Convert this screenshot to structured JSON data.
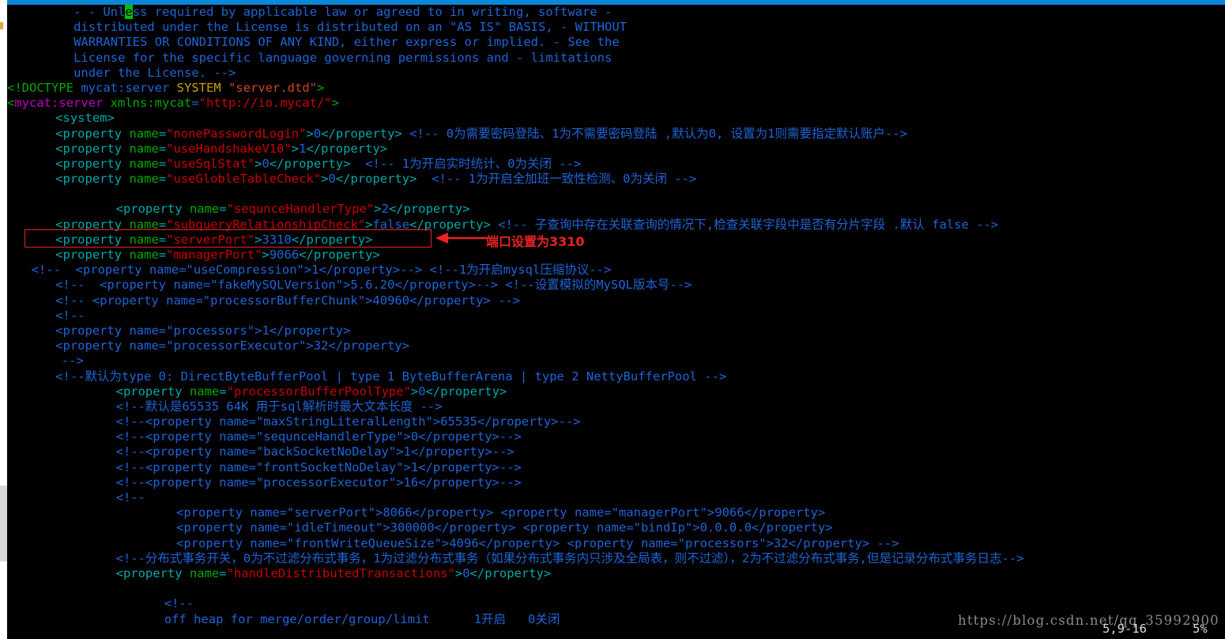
{
  "window": {
    "titlebar_color": "#0b87d8",
    "background": "#000000"
  },
  "editor": {
    "type": "vim",
    "filetype": "xml",
    "cursor": {
      "line": 5,
      "col": "9-16",
      "char": "e"
    },
    "status": {
      "position": "5,9-16",
      "percent": "5%"
    },
    "lines": [
      {
        "indent": 11,
        "segments": [
          {
            "t": "- - Unl",
            "c": "c-comment"
          },
          {
            "t": "e",
            "c": "cursor"
          },
          {
            "t": "ss required by applicable law or agreed to in writing, software -",
            "c": "c-comment"
          }
        ]
      },
      {
        "indent": 11,
        "segments": [
          {
            "t": "distributed under the License is distributed on an \"AS IS\" BASIS, - WITHOUT",
            "c": "c-comment"
          }
        ]
      },
      {
        "indent": 11,
        "segments": [
          {
            "t": "WARRANTIES OR CONDITIONS OF ANY KIND, either express or implied. - See the",
            "c": "c-comment"
          }
        ]
      },
      {
        "indent": 11,
        "segments": [
          {
            "t": "License for the specific language governing permissions and - limitations",
            "c": "c-comment"
          }
        ]
      },
      {
        "indent": 11,
        "segments": [
          {
            "t": "under the License. -->",
            "c": "c-comment"
          }
        ]
      },
      {
        "indent": 0,
        "segments": [
          {
            "t": "<!DOCTYPE",
            "c": "c-doctype"
          },
          {
            "t": " mycat:server ",
            "c": "c-plain"
          },
          {
            "t": "SYSTEM",
            "c": "c-dt-kw"
          },
          {
            "t": " ",
            "c": "c-plain"
          },
          {
            "t": "\"server.dtd\"",
            "c": "c-dt-str"
          },
          {
            "t": ">",
            "c": "c-doctype"
          }
        ]
      },
      {
        "indent": 0,
        "segments": [
          {
            "t": "<",
            "c": "c-doctype"
          },
          {
            "t": "mycat:server",
            "c": "c-ns"
          },
          {
            "t": " ",
            "c": "c-plain"
          },
          {
            "t": "xmlns:mycat",
            "c": "c-attr"
          },
          {
            "t": "=",
            "c": "c-plain"
          },
          {
            "t": "\"http://io.mycat/\"",
            "c": "c-str"
          },
          {
            "t": ">",
            "c": "c-doctype"
          }
        ]
      },
      {
        "indent": 8,
        "segments": [
          {
            "t": "<system>",
            "c": "c-tag"
          }
        ]
      },
      {
        "indent": 8,
        "segments": [
          {
            "t": "<property ",
            "c": "c-tag"
          },
          {
            "t": "name",
            "c": "c-attr"
          },
          {
            "t": "=",
            "c": "c-tag"
          },
          {
            "t": "\"nonePasswordLogin\"",
            "c": "c-str"
          },
          {
            "t": ">",
            "c": "c-tag"
          },
          {
            "t": "0",
            "c": "c-val"
          },
          {
            "t": "</property>",
            "c": "c-tag"
          },
          {
            "t": " <!-- 0为需要密码登陆、1为不需要密码登陆 ,默认为0, 设置为1则需要指定默认账户-->",
            "c": "c-comment"
          }
        ]
      },
      {
        "indent": 8,
        "segments": [
          {
            "t": "<property ",
            "c": "c-tag"
          },
          {
            "t": "name",
            "c": "c-attr"
          },
          {
            "t": "=",
            "c": "c-tag"
          },
          {
            "t": "\"useHandshakeV10\"",
            "c": "c-str"
          },
          {
            "t": ">",
            "c": "c-tag"
          },
          {
            "t": "1",
            "c": "c-val"
          },
          {
            "t": "</property>",
            "c": "c-tag"
          }
        ]
      },
      {
        "indent": 8,
        "segments": [
          {
            "t": "<property ",
            "c": "c-tag"
          },
          {
            "t": "name",
            "c": "c-attr"
          },
          {
            "t": "=",
            "c": "c-tag"
          },
          {
            "t": "\"useSqlStat\"",
            "c": "c-str"
          },
          {
            "t": ">",
            "c": "c-tag"
          },
          {
            "t": "0",
            "c": "c-val"
          },
          {
            "t": "</property>",
            "c": "c-tag"
          },
          {
            "t": "  <!-- 1为开启实时统计、0为关闭 -->",
            "c": "c-comment"
          }
        ]
      },
      {
        "indent": 8,
        "segments": [
          {
            "t": "<property ",
            "c": "c-tag"
          },
          {
            "t": "name",
            "c": "c-attr"
          },
          {
            "t": "=",
            "c": "c-tag"
          },
          {
            "t": "\"useGlobleTableCheck\"",
            "c": "c-str"
          },
          {
            "t": ">",
            "c": "c-tag"
          },
          {
            "t": "0",
            "c": "c-val"
          },
          {
            "t": "</property>",
            "c": "c-tag"
          },
          {
            "t": "  <!-- 1为开启全加班一致性检测、0为关闭 -->",
            "c": "c-comment"
          }
        ]
      },
      {
        "indent": 0,
        "segments": [
          {
            "t": "",
            "c": "c-plain"
          }
        ]
      },
      {
        "indent": 18,
        "segments": [
          {
            "t": "<property ",
            "c": "c-tag"
          },
          {
            "t": "name",
            "c": "c-attr"
          },
          {
            "t": "=",
            "c": "c-tag"
          },
          {
            "t": "\"sequnceHandlerType\"",
            "c": "c-str"
          },
          {
            "t": ">",
            "c": "c-tag"
          },
          {
            "t": "2",
            "c": "c-val"
          },
          {
            "t": "</property>",
            "c": "c-tag"
          }
        ]
      },
      {
        "indent": 8,
        "segments": [
          {
            "t": "<property ",
            "c": "c-tag"
          },
          {
            "t": "name",
            "c": "c-attr"
          },
          {
            "t": "=",
            "c": "c-tag"
          },
          {
            "t": "\"subqueryRelationshipCheck\"",
            "c": "c-str"
          },
          {
            "t": ">",
            "c": "c-tag"
          },
          {
            "t": "false",
            "c": "c-val"
          },
          {
            "t": "</property>",
            "c": "c-tag"
          },
          {
            "t": " <!-- 子查询中存在关联查询的情况下,检查关联字段中是否有分片字段 .默认 false -->",
            "c": "c-comment"
          }
        ]
      },
      {
        "indent": 8,
        "segments": [
          {
            "t": "<property ",
            "c": "c-tag"
          },
          {
            "t": "name",
            "c": "c-attr"
          },
          {
            "t": "=",
            "c": "c-tag"
          },
          {
            "t": "\"serverPort\"",
            "c": "c-str"
          },
          {
            "t": ">",
            "c": "c-tag"
          },
          {
            "t": "3310",
            "c": "c-val"
          },
          {
            "t": "</property>",
            "c": "c-tag"
          }
        ]
      },
      {
        "indent": 8,
        "segments": [
          {
            "t": "<property ",
            "c": "c-tag"
          },
          {
            "t": "name",
            "c": "c-attr"
          },
          {
            "t": "=",
            "c": "c-tag"
          },
          {
            "t": "\"managerPort\"",
            "c": "c-str"
          },
          {
            "t": ">",
            "c": "c-tag"
          },
          {
            "t": "9066",
            "c": "c-val"
          },
          {
            "t": "</property>",
            "c": "c-tag"
          }
        ]
      },
      {
        "indent": 4,
        "segments": [
          {
            "t": "<!--  <property name=\"useCompression\">1</property>--> <!--1为开启mysql压缩协议-->",
            "c": "c-comment"
          }
        ]
      },
      {
        "indent": 8,
        "segments": [
          {
            "t": "<!--  <property name=\"fakeMySQLVersion\">5.6.20</property>--> <!--设置模拟的MySQL版本号-->",
            "c": "c-comment"
          }
        ]
      },
      {
        "indent": 8,
        "segments": [
          {
            "t": "<!-- <property name=\"processorBufferChunk\">40960</property> -->",
            "c": "c-comment"
          }
        ]
      },
      {
        "indent": 8,
        "segments": [
          {
            "t": "<!--",
            "c": "c-comment"
          }
        ]
      },
      {
        "indent": 8,
        "segments": [
          {
            "t": "<property name=\"processors\">1</property>",
            "c": "c-comment"
          }
        ]
      },
      {
        "indent": 8,
        "segments": [
          {
            "t": "<property name=\"processorExecutor\">32</property>",
            "c": "c-comment"
          }
        ]
      },
      {
        "indent": 9,
        "segments": [
          {
            "t": "-->",
            "c": "c-comment"
          }
        ]
      },
      {
        "indent": 8,
        "segments": [
          {
            "t": "<!--默认为type 0: DirectByteBufferPool | type 1 ByteBufferArena | type 2 NettyBufferPool -->",
            "c": "c-comment"
          }
        ]
      },
      {
        "indent": 18,
        "segments": [
          {
            "t": "<property ",
            "c": "c-tag"
          },
          {
            "t": "name",
            "c": "c-attr"
          },
          {
            "t": "=",
            "c": "c-tag"
          },
          {
            "t": "\"processorBufferPoolType\"",
            "c": "c-str"
          },
          {
            "t": ">",
            "c": "c-tag"
          },
          {
            "t": "0",
            "c": "c-val"
          },
          {
            "t": "</property>",
            "c": "c-tag"
          }
        ]
      },
      {
        "indent": 18,
        "segments": [
          {
            "t": "<!--默认是65535 64K 用于sql解析时最大文本长度 -->",
            "c": "c-comment"
          }
        ]
      },
      {
        "indent": 18,
        "segments": [
          {
            "t": "<!--<property name=\"maxStringLiteralLength\">65535</property>-->",
            "c": "c-comment"
          }
        ]
      },
      {
        "indent": 18,
        "segments": [
          {
            "t": "<!--<property name=\"sequnceHandlerType\">0</property>-->",
            "c": "c-comment"
          }
        ]
      },
      {
        "indent": 18,
        "segments": [
          {
            "t": "<!--<property name=\"backSocketNoDelay\">1</property>-->",
            "c": "c-comment"
          }
        ]
      },
      {
        "indent": 18,
        "segments": [
          {
            "t": "<!--<property name=\"frontSocketNoDelay\">1</property>-->",
            "c": "c-comment"
          }
        ]
      },
      {
        "indent": 18,
        "segments": [
          {
            "t": "<!--<property name=\"processorExecutor\">16</property>-->",
            "c": "c-comment"
          }
        ]
      },
      {
        "indent": 18,
        "segments": [
          {
            "t": "<!--",
            "c": "c-comment"
          }
        ]
      },
      {
        "indent": 28,
        "segments": [
          {
            "t": "<property name=\"serverPort\">8066</property> <property name=\"managerPort\">9066</property>",
            "c": "c-comment"
          }
        ]
      },
      {
        "indent": 28,
        "segments": [
          {
            "t": "<property name=\"idleTimeout\">300000</property> <property name=\"bindIp\">0.0.0.0</property>",
            "c": "c-comment"
          }
        ]
      },
      {
        "indent": 28,
        "segments": [
          {
            "t": "<property name=\"frontWriteQueueSize\">4096</property> <property name=\"processors\">32</property> -->",
            "c": "c-comment"
          }
        ]
      },
      {
        "indent": 18,
        "segments": [
          {
            "t": "<!--分布式事务开关，0为不过滤分布式事务，1为过滤分布式事务（如果分布式事务内只涉及全局表，则不过滤），2为不过滤分布式事务,但是记录分布式事务日志-->",
            "c": "c-comment"
          }
        ]
      },
      {
        "indent": 18,
        "segments": [
          {
            "t": "<property ",
            "c": "c-tag"
          },
          {
            "t": "name",
            "c": "c-attr"
          },
          {
            "t": "=",
            "c": "c-tag"
          },
          {
            "t": "\"handleDistributedTransactions\"",
            "c": "c-str"
          },
          {
            "t": ">",
            "c": "c-tag"
          },
          {
            "t": "0",
            "c": "c-val"
          },
          {
            "t": "</property>",
            "c": "c-tag"
          }
        ]
      },
      {
        "indent": 0,
        "segments": [
          {
            "t": "",
            "c": "c-plain"
          }
        ]
      },
      {
        "indent": 26,
        "segments": [
          {
            "t": "<!--",
            "c": "c-comment"
          }
        ]
      },
      {
        "indent": 26,
        "segments": [
          {
            "t": "off heap for merge/order/group/limit      1开启   0关闭",
            "c": "c-comment"
          }
        ]
      }
    ]
  },
  "annotation": {
    "box_label": "serverPort-highlight",
    "arrow_label": "annotation-arrow",
    "text": "端口设置为3310",
    "color": "#ee2222"
  },
  "watermark": {
    "text": "https://blog.csdn.net/qq_35992900"
  }
}
